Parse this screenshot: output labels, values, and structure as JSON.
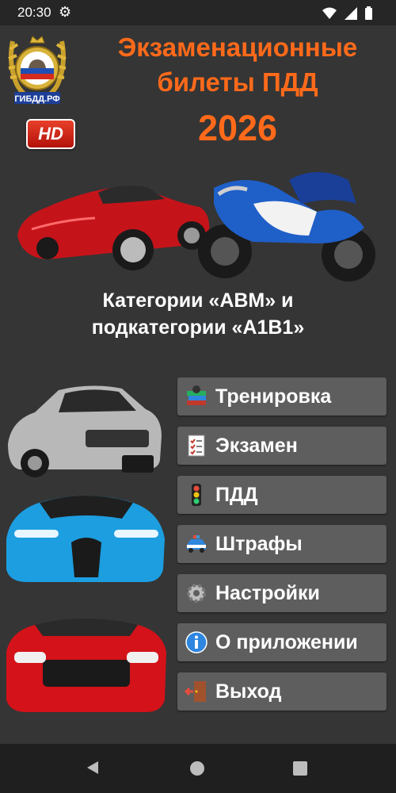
{
  "status_bar": {
    "time": "20:30"
  },
  "header": {
    "emblem_text": "ГИБДД.РФ",
    "hd_badge": "HD",
    "title_line1": "Экзаменационные",
    "title_line2": "билеты ПДД",
    "year": "2026"
  },
  "subtitle": {
    "line1": "Категории «ABM» и",
    "line2": "подкатегории «A1B1»"
  },
  "menu": {
    "items": [
      {
        "label": "Тренировка",
        "icon": "books-icon"
      },
      {
        "label": "Экзамен",
        "icon": "checklist-icon"
      },
      {
        "label": "ПДД",
        "icon": "traffic-light-icon"
      },
      {
        "label": "Штрафы",
        "icon": "police-car-icon"
      },
      {
        "label": "Настройки",
        "icon": "gear-icon"
      },
      {
        "label": "О приложении",
        "icon": "info-icon"
      },
      {
        "label": "Выход",
        "icon": "exit-door-icon"
      }
    ]
  },
  "colors": {
    "accent": "#ff6a1a",
    "background": "#353535",
    "button": "#5e5e5e"
  }
}
